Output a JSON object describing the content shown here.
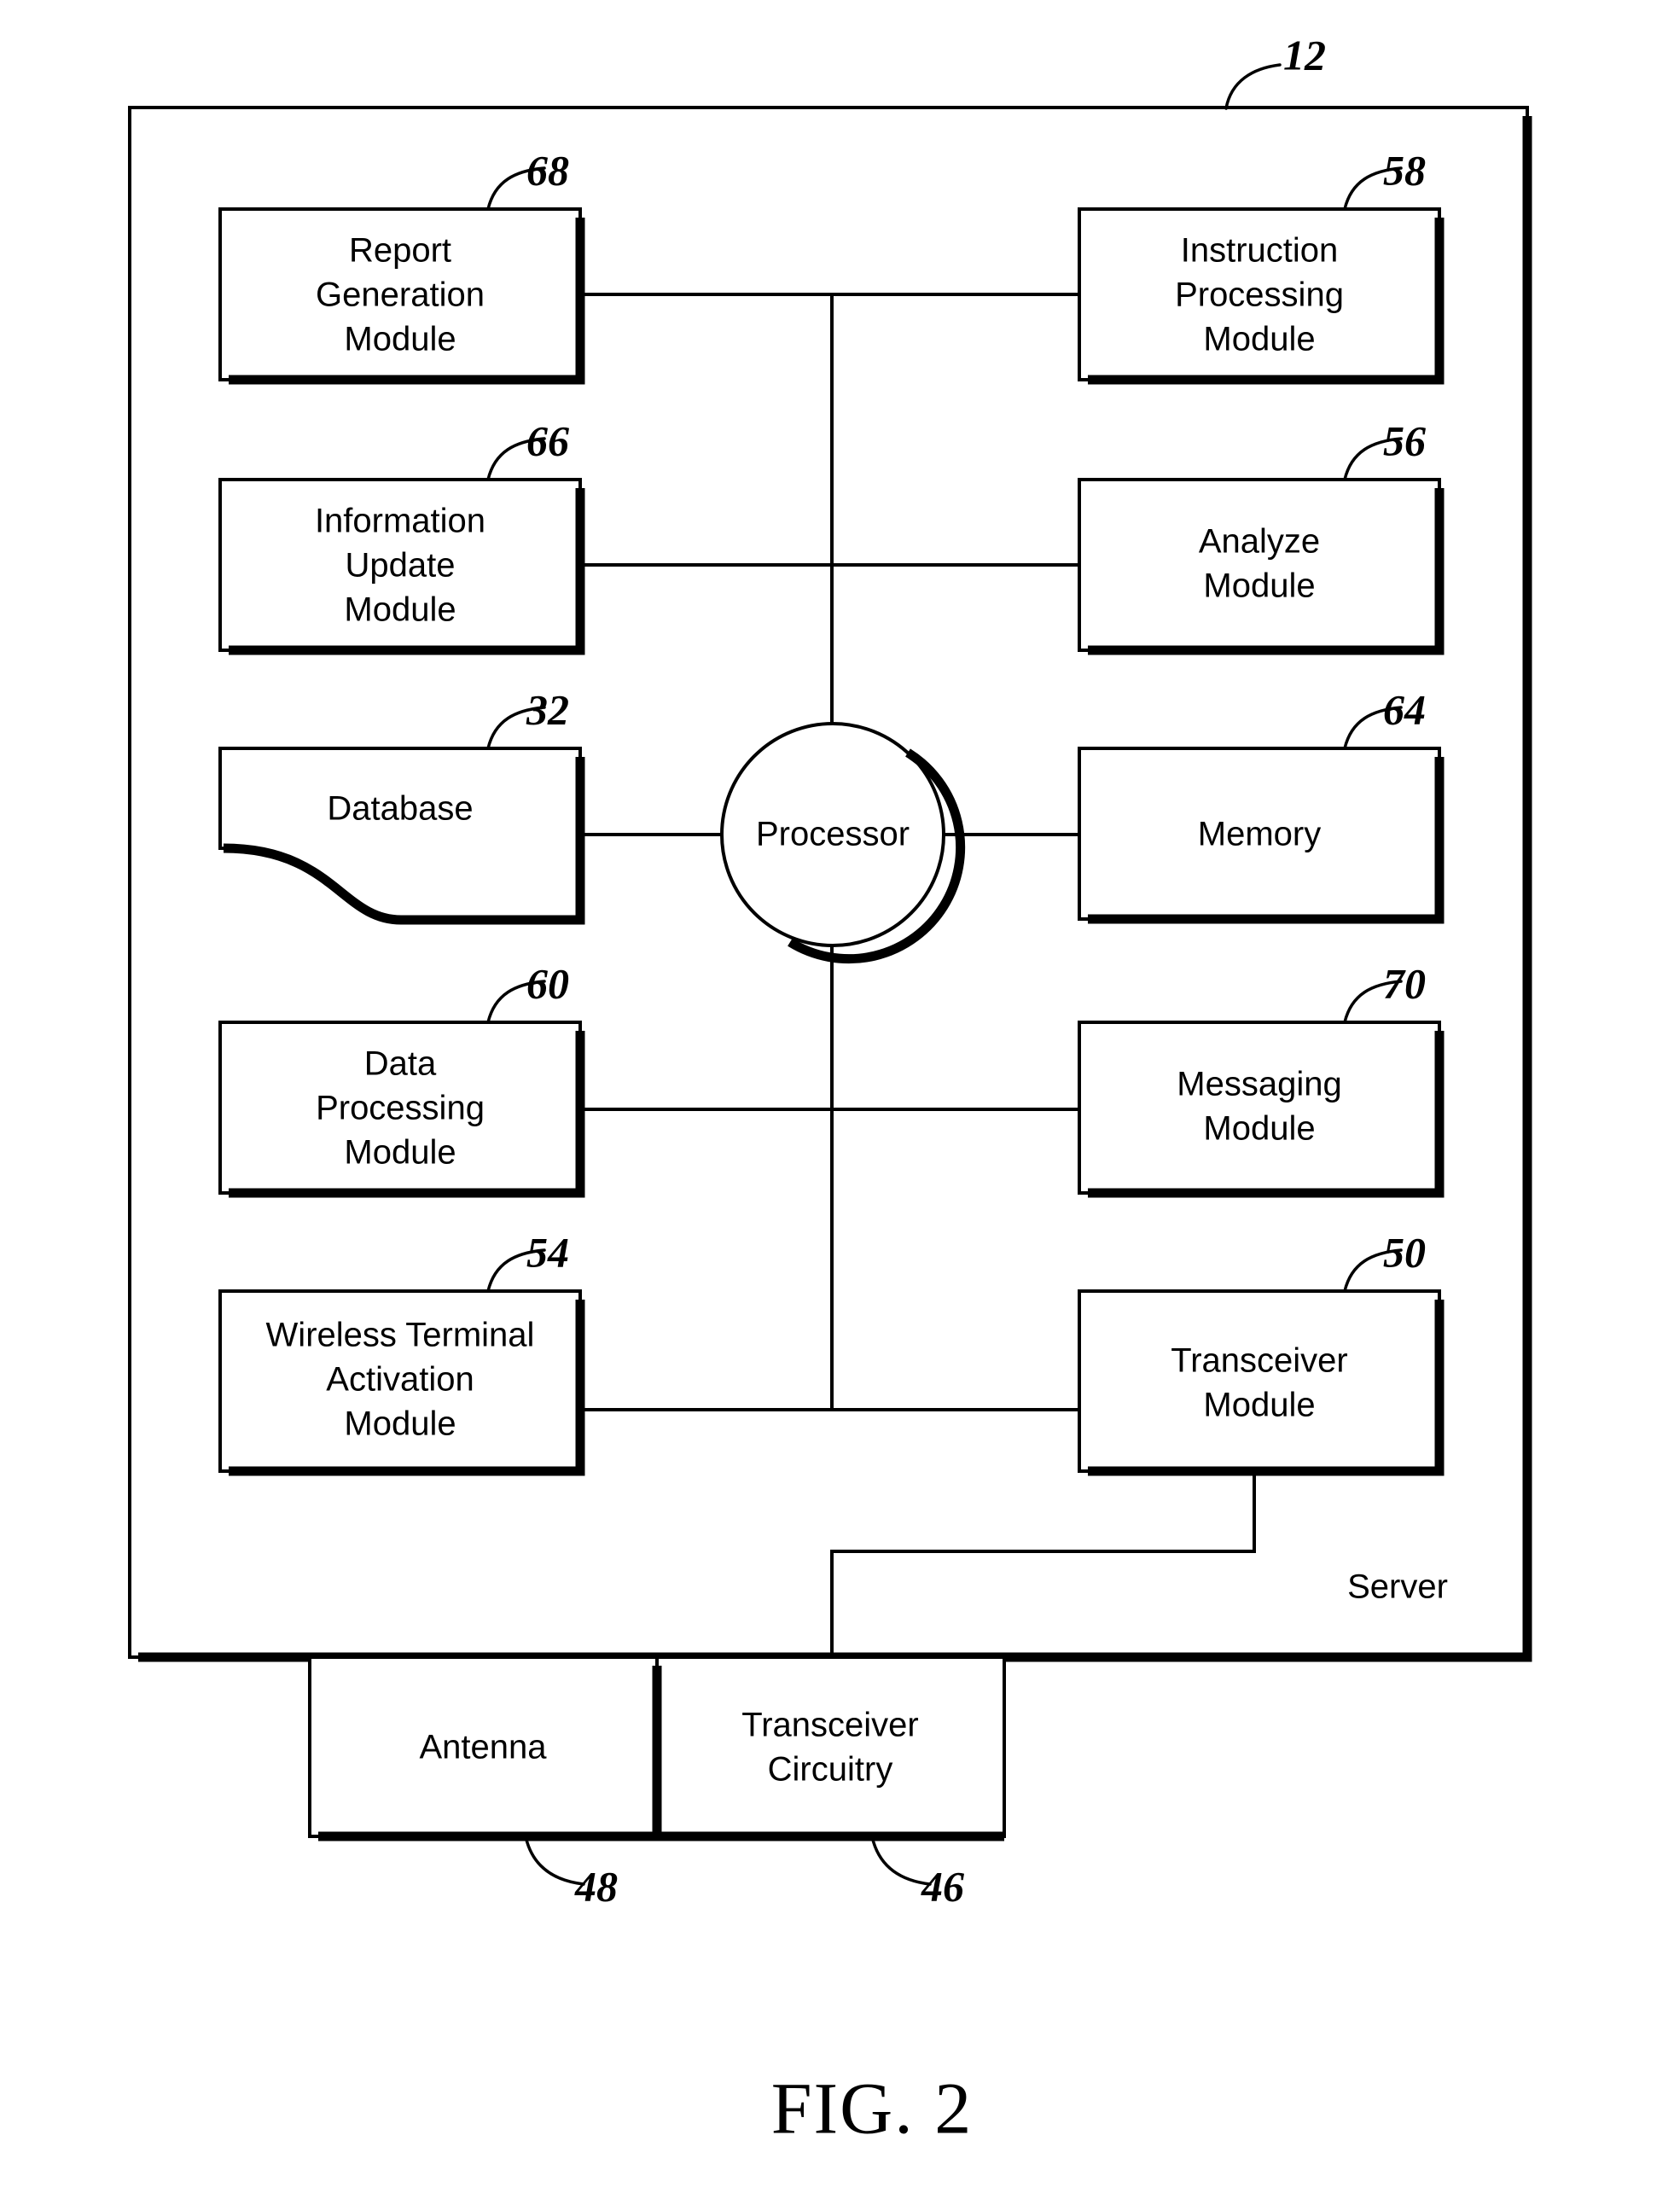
{
  "figure": {
    "caption": "FIG. 2",
    "container_label": "Server",
    "container_ref": "12"
  },
  "modules": {
    "report_generation": {
      "lines": [
        "Report",
        "Generation",
        "Module"
      ],
      "ref": "68"
    },
    "instruction_processing": {
      "lines": [
        "Instruction",
        "Processing",
        "Module"
      ],
      "ref": "58"
    },
    "information_update": {
      "lines": [
        "Information",
        "Update",
        "Module"
      ],
      "ref": "66"
    },
    "analyze": {
      "lines": [
        "Analyze",
        "Module"
      ],
      "ref": "56"
    },
    "database": {
      "lines": [
        "Database"
      ],
      "ref": "32"
    },
    "processor": {
      "lines": [
        "Processor"
      ],
      "ref": ""
    },
    "memory": {
      "lines": [
        "Memory"
      ],
      "ref": "64"
    },
    "data_processing": {
      "lines": [
        "Data",
        "Processing",
        "Module"
      ],
      "ref": "60"
    },
    "messaging": {
      "lines": [
        "Messaging",
        "Module"
      ],
      "ref": "70"
    },
    "wireless_terminal_activation": {
      "lines": [
        "Wireless Terminal",
        "Activation",
        "Module"
      ],
      "ref": "54"
    },
    "transceiver_module": {
      "lines": [
        "Transceiver",
        "Module"
      ],
      "ref": "50"
    },
    "antenna": {
      "lines": [
        "Antenna"
      ],
      "ref": "48"
    },
    "transceiver_circuitry": {
      "lines": [
        "Transceiver",
        "Circuitry"
      ],
      "ref": "46"
    }
  },
  "colors": {
    "line": "#000000",
    "fill": "#ffffff",
    "background": "#ffffff"
  },
  "chart_data": {
    "type": "diagram",
    "title": "FIG. 2",
    "diagram_kind": "block-diagram",
    "container": {
      "label": "Server",
      "ref": "12"
    },
    "nodes": [
      {
        "id": "report_generation",
        "label": "Report Generation Module",
        "ref": "68",
        "shape": "rect",
        "column": "left",
        "row": 1
      },
      {
        "id": "instruction_processing",
        "label": "Instruction Processing Module",
        "ref": "58",
        "shape": "rect",
        "column": "right",
        "row": 1
      },
      {
        "id": "information_update",
        "label": "Information Update Module",
        "ref": "66",
        "shape": "rect",
        "column": "left",
        "row": 2
      },
      {
        "id": "analyze",
        "label": "Analyze Module",
        "ref": "56",
        "shape": "rect",
        "column": "right",
        "row": 2
      },
      {
        "id": "database",
        "label": "Database",
        "ref": "32",
        "shape": "wavy-bottom-rect",
        "column": "left",
        "row": 3
      },
      {
        "id": "processor",
        "label": "Processor",
        "ref": "",
        "shape": "circle",
        "column": "center",
        "row": 3
      },
      {
        "id": "memory",
        "label": "Memory",
        "ref": "64",
        "shape": "rect",
        "column": "right",
        "row": 3
      },
      {
        "id": "data_processing",
        "label": "Data Processing Module",
        "ref": "60",
        "shape": "rect",
        "column": "left",
        "row": 4
      },
      {
        "id": "messaging",
        "label": "Messaging Module",
        "ref": "70",
        "shape": "rect",
        "column": "right",
        "row": 4
      },
      {
        "id": "wireless_terminal_activation",
        "label": "Wireless Terminal Activation Module",
        "ref": "54",
        "shape": "rect",
        "column": "left",
        "row": 5
      },
      {
        "id": "transceiver_module",
        "label": "Transceiver Module",
        "ref": "50",
        "shape": "rect",
        "column": "right",
        "row": 5
      },
      {
        "id": "antenna",
        "label": "Antenna",
        "ref": "48",
        "shape": "rect",
        "column": "outside-left",
        "row": 6
      },
      {
        "id": "transceiver_circuitry",
        "label": "Transceiver Circuitry",
        "ref": "46",
        "shape": "rect",
        "column": "outside-right",
        "row": 6
      }
    ],
    "edges": [
      {
        "from": "report_generation",
        "to": "instruction_processing",
        "via": "bus"
      },
      {
        "from": "information_update",
        "to": "analyze",
        "via": "bus"
      },
      {
        "from": "database",
        "to": "processor",
        "via": "direct"
      },
      {
        "from": "processor",
        "to": "memory",
        "via": "direct"
      },
      {
        "from": "data_processing",
        "to": "messaging",
        "via": "bus"
      },
      {
        "from": "wireless_terminal_activation",
        "to": "transceiver_module",
        "via": "bus"
      },
      {
        "from": "processor",
        "to": "bus",
        "via": "vertical-bus"
      },
      {
        "from": "transceiver_module",
        "to": "transceiver_circuitry",
        "via": "routed"
      },
      {
        "from": "antenna",
        "to": "transceiver_circuitry",
        "via": "adjacent"
      }
    ]
  }
}
